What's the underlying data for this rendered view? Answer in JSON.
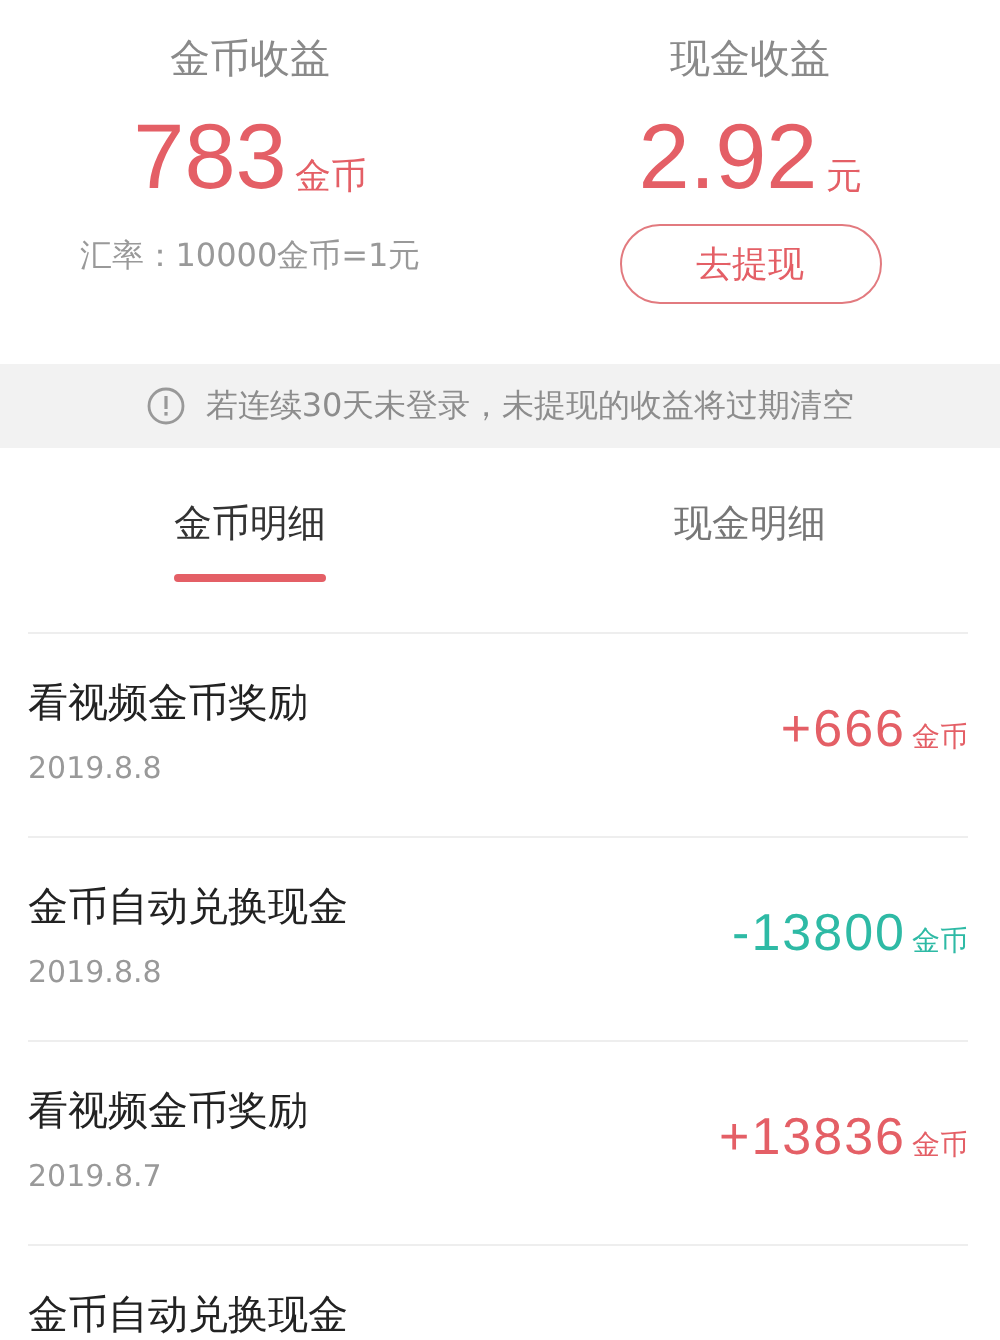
{
  "summary": [
    {
      "title": "金币收益",
      "value": "783",
      "unit": "金币",
      "note": "汇率：10000金币=1元"
    },
    {
      "title": "现金收益",
      "value": "2.92",
      "unit": "元",
      "button": "去提现"
    }
  ],
  "notice": "若连续30天未登录，未提现的收益将过期清空",
  "tabs": [
    {
      "label": "金币明细",
      "selected": true
    },
    {
      "label": "现金明细",
      "selected": false
    }
  ],
  "records": [
    {
      "title": "看视频金币奖励",
      "date": "2019.8.8",
      "kind": "income",
      "amount": "+666",
      "unit": "金币"
    },
    {
      "title": "金币自动兑换现金",
      "date": "2019.8.8",
      "kind": "expense",
      "amount": "-13800",
      "unit": "金币"
    },
    {
      "title": "看视频金币奖励",
      "date": "2019.8.7",
      "kind": "income",
      "amount": "+13836",
      "unit": "金币"
    },
    {
      "title": "金币自动兑换现金"
    }
  ]
}
